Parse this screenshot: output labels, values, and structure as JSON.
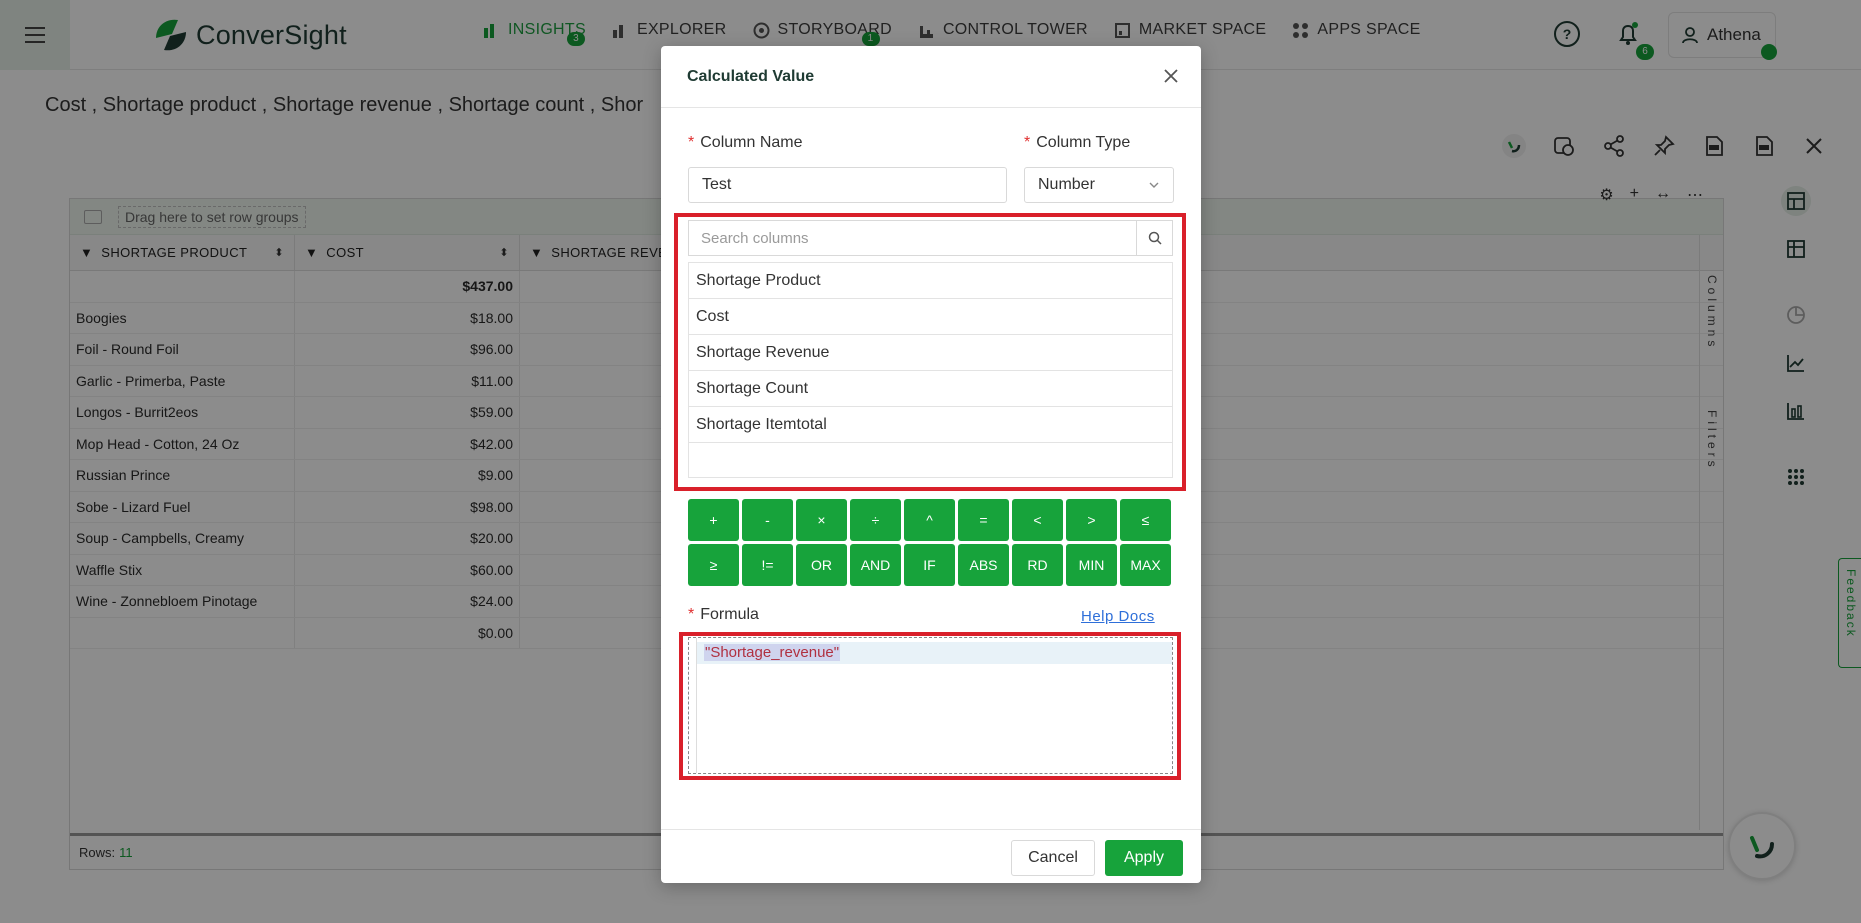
{
  "brand": {
    "name": "ConverSight"
  },
  "nav": {
    "items": [
      {
        "label": "INSIGHTS",
        "icon": "bar-chart-icon",
        "badge": "3",
        "active": true
      },
      {
        "label": "EXPLORER",
        "icon": "explorer-icon",
        "badge": "",
        "active": false
      },
      {
        "label": "STORYBOARD",
        "icon": "storyboard-icon",
        "badge": "1",
        "active": false
      },
      {
        "label": "CONTROL TOWER",
        "icon": "control-tower-icon",
        "badge": "",
        "active": false
      },
      {
        "label": "MARKET SPACE",
        "icon": "market-space-icon",
        "badge": "",
        "active": false
      },
      {
        "label": "APPS SPACE",
        "icon": "apps-space-icon",
        "badge": "",
        "active": false
      }
    ],
    "notifications_count": "6",
    "user_name": "Athena"
  },
  "page": {
    "subtitle": "Cost , Shortage product , Shortage revenue , Shortage count , Shor"
  },
  "grid": {
    "group_bar_text": "Drag here to set row groups",
    "columns": [
      "SHORTAGE PRODUCT",
      "COST",
      "SHORTAGE REVE"
    ],
    "total_row": {
      "product": "",
      "cost": "$437.00"
    },
    "rows": [
      {
        "product": "Boogies",
        "cost": "$18.00"
      },
      {
        "product": "Foil - Round Foil",
        "cost": "$96.00"
      },
      {
        "product": "Garlic - Primerba, Paste",
        "cost": "$11.00"
      },
      {
        "product": "Longos - Burrit2eos",
        "cost": "$59.00"
      },
      {
        "product": "Mop Head - Cotton, 24 Oz",
        "cost": "$42.00"
      },
      {
        "product": "Russian Prince",
        "cost": "$9.00"
      },
      {
        "product": "Sobe - Lizard Fuel",
        "cost": "$98.00"
      },
      {
        "product": "Soup - Campbells, Creamy",
        "cost": "$20.00"
      },
      {
        "product": "Waffle Stix",
        "cost": "$60.00"
      },
      {
        "product": "Wine - Zonnebloem Pinotage",
        "cost": "$24.00"
      },
      {
        "product": "",
        "cost": "$0.00"
      }
    ],
    "side_columns_label": "Columns",
    "side_filters_label": "Filters",
    "rows_label": "Rows:",
    "rows_count": "11"
  },
  "feedback_label": "Feedback",
  "modal": {
    "title": "Calculated Value",
    "column_name_label": "Column Name",
    "column_name_value": "Test",
    "column_type_label": "Column Type",
    "column_type_value": "Number",
    "search_placeholder": "Search columns",
    "column_list": [
      "Shortage Product",
      "Cost",
      "Shortage Revenue",
      "Shortage Count",
      "Shortage Itemtotal"
    ],
    "operators": [
      "+",
      "-",
      "×",
      "÷",
      "^",
      "=",
      "<",
      ">",
      "≤",
      "≥",
      "!=",
      "OR",
      "AND",
      "IF",
      "ABS",
      "RD",
      "MIN",
      "MAX"
    ],
    "formula_label": "Formula",
    "help_docs_label": "Help Docs",
    "formula_value": "\"Shortage_revenue\"",
    "cancel_label": "Cancel",
    "apply_label": "Apply"
  },
  "colors": {
    "accent": "#17a33b",
    "highlight": "#d9202a",
    "link": "#2e6fd9"
  }
}
